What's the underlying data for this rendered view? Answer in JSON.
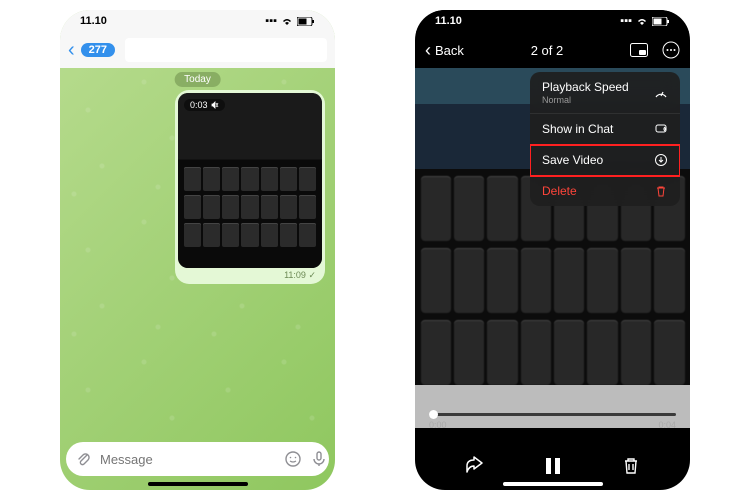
{
  "left": {
    "status_time": "11.10",
    "unread_count": "277",
    "date_pill": "Today",
    "video_duration": "0:03",
    "msg_time": "11:09",
    "msg_check": "✓",
    "input_placeholder": "Message"
  },
  "right": {
    "status_time": "11.10",
    "back_label": "Back",
    "counter": "2 of 2",
    "menu": {
      "playback": {
        "label": "Playback Speed",
        "sub": "Normal"
      },
      "show_in_chat": "Show in Chat",
      "save_video": "Save Video",
      "delete": "Delete"
    },
    "scrub_start": "0:00",
    "scrub_end": "0:04"
  }
}
